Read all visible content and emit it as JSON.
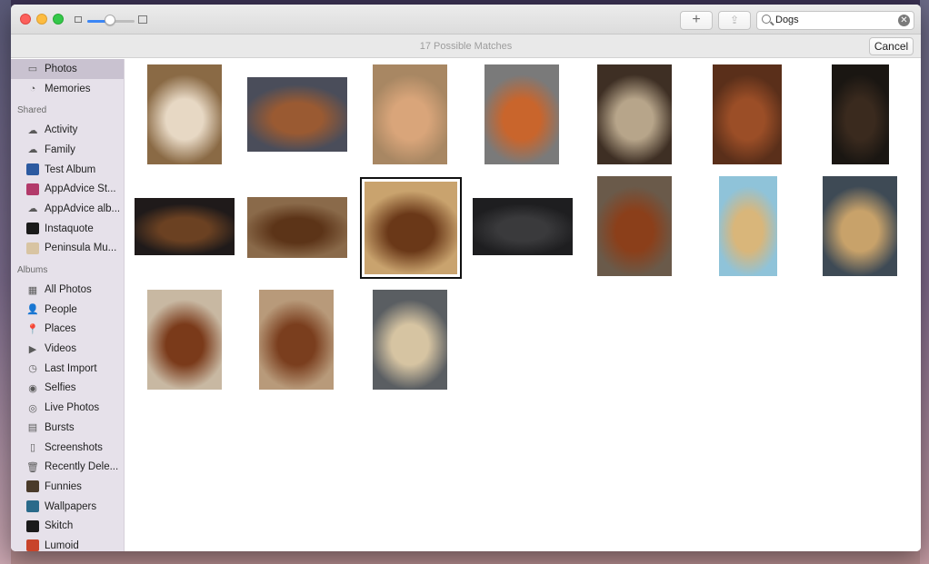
{
  "toolbar": {
    "add_label": "+",
    "share_label": "⇪",
    "search_value": "Dogs",
    "clear_label": "✕"
  },
  "subbar": {
    "matches_text": "17 Possible Matches",
    "cancel_label": "Cancel"
  },
  "sidebar": {
    "items_top": [
      {
        "label": "Photos",
        "icon": "photos-icon",
        "selected": true
      },
      {
        "label": "Memories",
        "icon": "memories-icon"
      }
    ],
    "shared_header": "Shared",
    "shared": [
      {
        "label": "Activity",
        "icon": "cloud-icon"
      },
      {
        "label": "Family",
        "icon": "cloud-icon"
      },
      {
        "label": "Test Album",
        "icon": "album-thumb-icon"
      },
      {
        "label": "AppAdvice St...",
        "icon": "album-thumb-icon"
      },
      {
        "label": "AppAdvice alb...",
        "icon": "cloud-icon"
      },
      {
        "label": "Instaquote",
        "icon": "album-thumb-icon"
      },
      {
        "label": "Peninsula Mu...",
        "icon": "album-thumb-icon"
      }
    ],
    "albums_header": "Albums",
    "albums": [
      {
        "label": "All Photos",
        "icon": "grid-icon"
      },
      {
        "label": "People",
        "icon": "person-icon"
      },
      {
        "label": "Places",
        "icon": "pin-icon"
      },
      {
        "label": "Videos",
        "icon": "video-icon"
      },
      {
        "label": "Last Import",
        "icon": "clock-icon"
      },
      {
        "label": "Selfies",
        "icon": "selfie-icon"
      },
      {
        "label": "Live Photos",
        "icon": "live-icon"
      },
      {
        "label": "Bursts",
        "icon": "burst-icon"
      },
      {
        "label": "Screenshots",
        "icon": "phone-icon"
      },
      {
        "label": "Recently Dele...",
        "icon": "trash-icon"
      },
      {
        "label": "Funnies",
        "icon": "album-thumb-icon"
      },
      {
        "label": "Wallpapers",
        "icon": "album-thumb-icon"
      },
      {
        "label": "Skitch",
        "icon": "album-thumb-icon"
      },
      {
        "label": "Lumoid",
        "icon": "album-thumb-icon"
      }
    ]
  },
  "colors": {
    "selected_item": "#c9c2d0",
    "sidebar_bg": "#e6e1ea",
    "accent": "#3b86f5"
  },
  "photos": [
    {
      "name": "photo-dog-1",
      "bg": "#8a6a45",
      "fg": "#e7d8c4",
      "selected": false
    },
    {
      "name": "photo-dog-2",
      "bg": "#4a4d5a",
      "fg": "#9a5a32",
      "selected": false
    },
    {
      "name": "photo-dog-3",
      "bg": "#a88763",
      "fg": "#d9a57a",
      "selected": false
    },
    {
      "name": "photo-dog-4",
      "bg": "#7a7a7a",
      "fg": "#c9652c",
      "selected": false
    },
    {
      "name": "photo-dog-5",
      "bg": "#3e2f24",
      "fg": "#b7a58a",
      "selected": false
    },
    {
      "name": "photo-dog-6",
      "bg": "#5a2f1a",
      "fg": "#9b4e27",
      "selected": false
    },
    {
      "name": "photo-dog-7",
      "bg": "#1a1612",
      "fg": "#3a2a1e",
      "selected": false
    },
    {
      "name": "photo-dog-8",
      "bg": "#1f1a1a",
      "fg": "#6b4122",
      "selected": false
    },
    {
      "name": "photo-dog-9",
      "bg": "#8a6a4a",
      "fg": "#5c3418",
      "selected": false
    },
    {
      "name": "photo-dog-10",
      "bg": "#c9a36e",
      "fg": "#6a3818",
      "selected": true
    },
    {
      "name": "photo-dog-11",
      "bg": "#1e1e20",
      "fg": "#3a3a3c",
      "selected": false
    },
    {
      "name": "photo-dog-12",
      "bg": "#6a5a4a",
      "fg": "#8b3f1a",
      "selected": false
    },
    {
      "name": "photo-dog-13",
      "bg": "#8fc3d9",
      "fg": "#d9b67a",
      "selected": false
    },
    {
      "name": "photo-dog-14",
      "bg": "#3e4a55",
      "fg": "#c8a26a",
      "selected": false
    },
    {
      "name": "photo-dog-15",
      "bg": "#c8b8a2",
      "fg": "#7a3a1a",
      "selected": false
    },
    {
      "name": "photo-dog-16",
      "bg": "#b89a7a",
      "fg": "#7a3e1e",
      "selected": false
    },
    {
      "name": "photo-dog-17",
      "bg": "#5a5e62",
      "fg": "#d6c4a2",
      "selected": false
    }
  ]
}
